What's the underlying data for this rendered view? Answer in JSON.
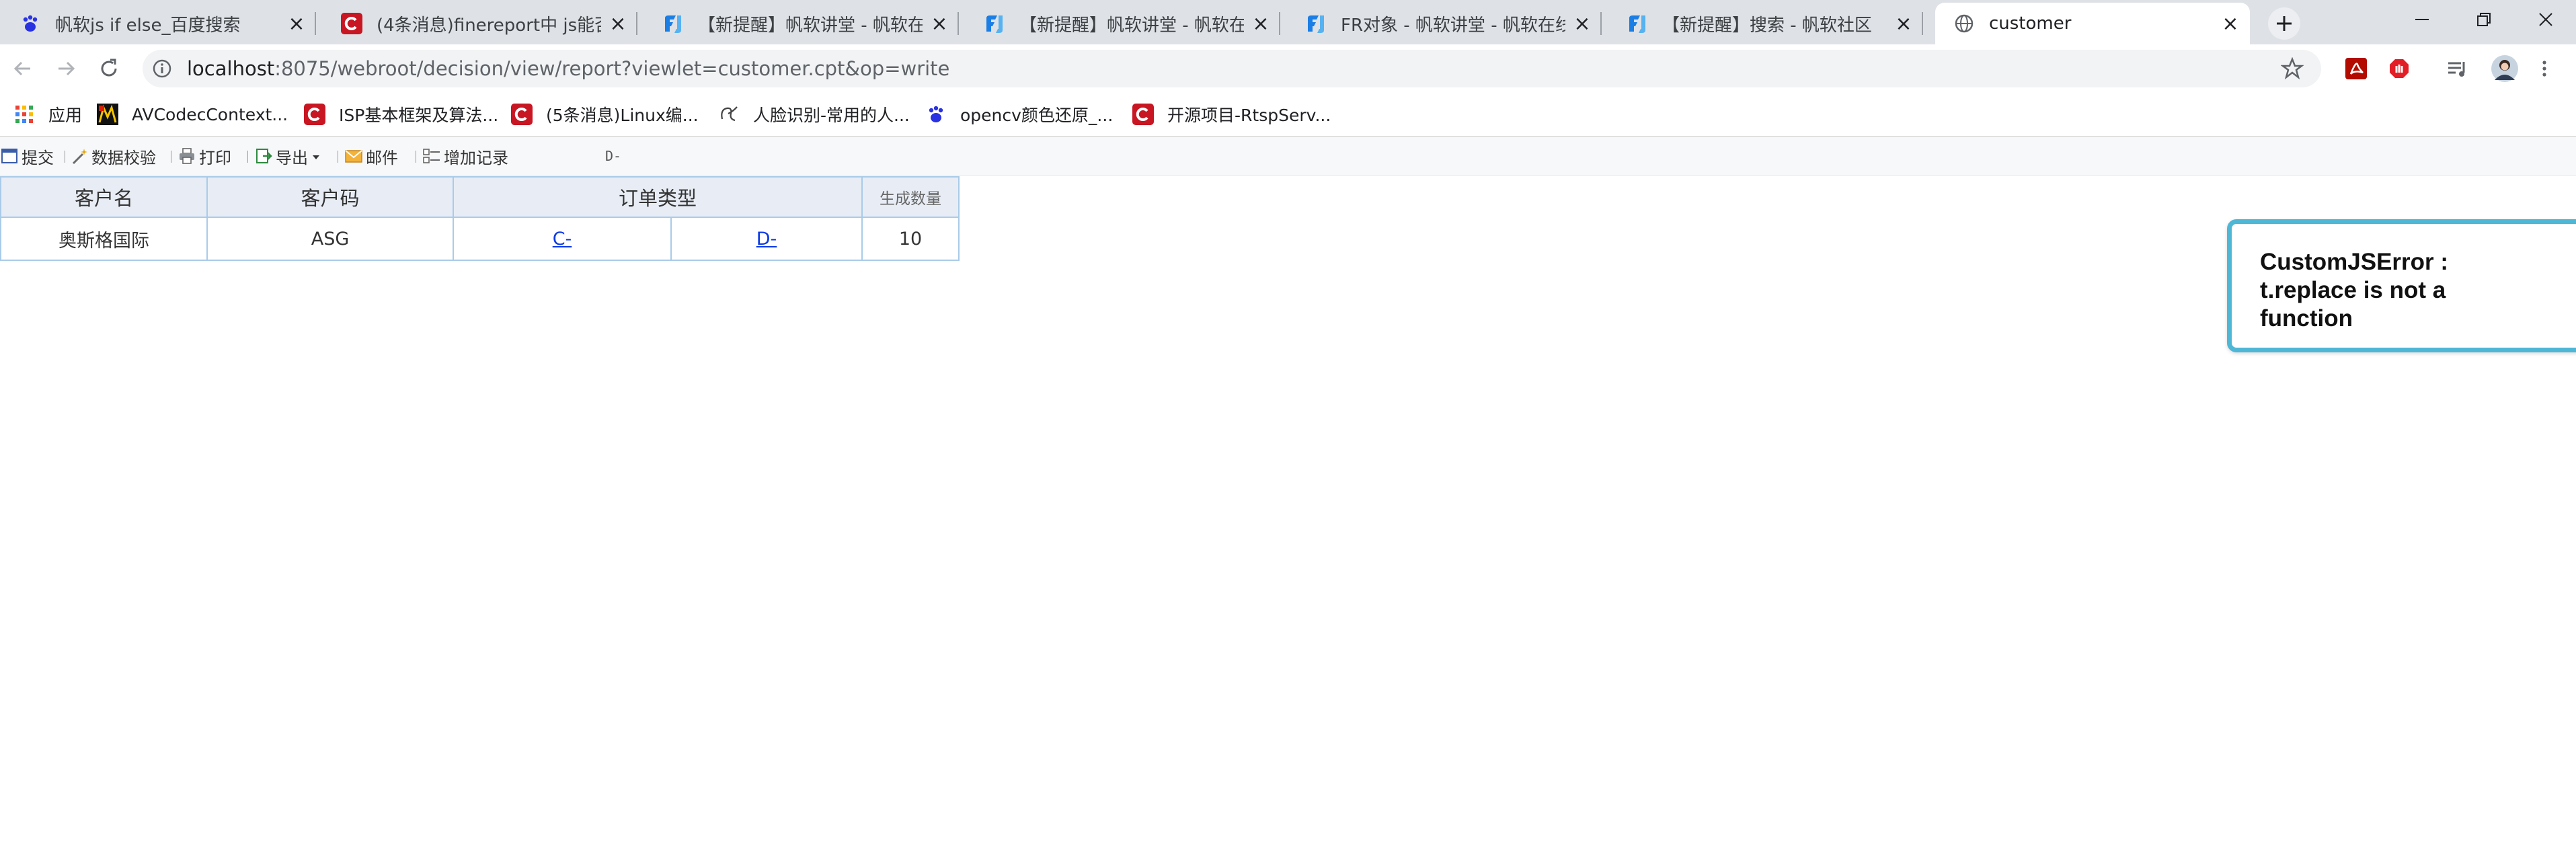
{
  "browser": {
    "tabs": [
      {
        "title": "帆软js if else_百度搜索",
        "icon": "baidu-paw-icon"
      },
      {
        "title": "(4条消息)finereport中 js能否可以",
        "icon": "csdn-icon"
      },
      {
        "title": "【新提醒】帆软讲堂 - 帆软在线视",
        "icon": "fanruan-icon"
      },
      {
        "title": "【新提醒】帆软讲堂 - 帆软在线视",
        "icon": "fanruan-icon"
      },
      {
        "title": "FR对象 - 帆软讲堂 - 帆软在线视频",
        "icon": "fanruan-icon"
      },
      {
        "title": "【新提醒】搜索 - 帆软社区",
        "icon": "fanruan-icon"
      },
      {
        "title": "customer",
        "icon": "globe-icon"
      }
    ],
    "url_host": "localhost",
    "url_rest": ":8075/webroot/decision/view/report?viewlet=customer.cpt&op=write",
    "bookmarks": [
      {
        "label": "应用",
        "icon": "apps-grid-icon"
      },
      {
        "label": "AVCodecContext...",
        "icon": "bookmark-icon"
      },
      {
        "label": "ISP基本框架及算法...",
        "icon": "csdn-icon"
      },
      {
        "label": "(5条消息)Linux编...",
        "icon": "csdn-icon"
      },
      {
        "label": "人脸识别-常用的人...",
        "icon": "bookmark-icon"
      },
      {
        "label": "opencv颜色还原_...",
        "icon": "baidu-paw-icon"
      },
      {
        "label": "开源项目-RtspServ...",
        "icon": "csdn-icon"
      }
    ]
  },
  "report_toolbar": {
    "submit": "提交",
    "validate": "数据校验",
    "print": "打印",
    "export": "导出",
    "mail": "邮件",
    "add_record": "增加记录",
    "status_text": "D-"
  },
  "report_table": {
    "headers": {
      "customer_name": "客户名",
      "customer_code": "客户码",
      "order_type": "订单类型",
      "gen_count": "生成数量"
    },
    "rows": [
      {
        "customer_name": "奥斯格国际",
        "customer_code": "ASG",
        "type_c": "C-",
        "type_d": "D-",
        "count": "10"
      }
    ]
  },
  "error_toast": {
    "message": "CustomJSError : t.replace is not a function",
    "color": "#4fb7d6"
  }
}
